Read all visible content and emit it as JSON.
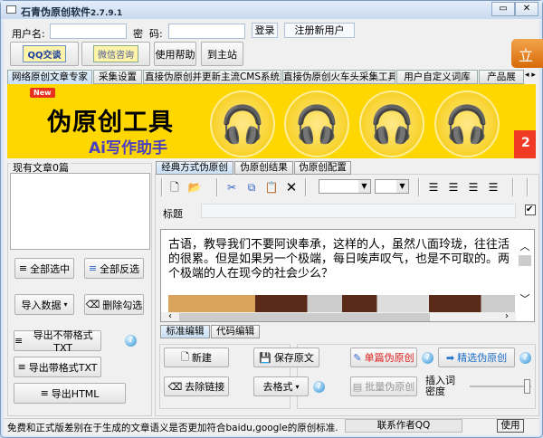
{
  "window": {
    "title": "石青伪原创软件",
    "version": "2.7.9.1",
    "min": "▭",
    "close": "✕"
  },
  "login": {
    "username_label": "用户名:",
    "username_value": "",
    "password_label": "密  码:",
    "password_value": "",
    "login_button": "登录",
    "register_button": "注册新用户"
  },
  "toolbar": {
    "qq": "QQ交谈",
    "wechat": "微信咨询",
    "help": "使用帮助",
    "home": "到主站",
    "orange": "立"
  },
  "tabs": [
    "网络原创文章专家",
    "采集设置",
    "直接伪原创并更新主流CMS系统",
    "直接伪原创火车头采集工具",
    "用户自定义词库",
    "产品展"
  ],
  "banner": {
    "badge": "New",
    "title": "伪原创工具",
    "subtitle": "Ai写作助手",
    "side": "2"
  },
  "left": {
    "group_title": "现有文章0篇",
    "select_all": "全部选中",
    "invert": "全部反选",
    "import": "导入数据",
    "delete_checked": "删除勾选",
    "export_plain": "导出不带格式TXT",
    "export_fmt": "导出带格式TXT",
    "export_html": "导出HTML"
  },
  "right": {
    "tabs": [
      "经典方式伪原创",
      "伪原创结果",
      "伪原创配置"
    ],
    "title_label": "标题",
    "title_value": "",
    "editor_text": "古语，教导我们不要阿谀奉承，这样的人，虽然八面玲珑，往往活的很累。但是如果另一个极端，每日唉声叹气，也是不可取的。两个极端的人在现今的社会少么？",
    "edit_tabs": [
      "标准编辑",
      "代码编辑"
    ],
    "new": "新建",
    "save": "保存原文",
    "remove_links": "去除链接",
    "remove_format": "去格式",
    "single": "单篇伪原创",
    "selected": "精选伪原创",
    "batch": "批量伪原创",
    "density_label": "插入词密度",
    "density_value": 1.0
  },
  "status": {
    "message": "免费和正式版差别在于生成的文章语义是否更加符合baidu,google的原创标准.",
    "contact": "联系作者QQ",
    "usage": "使用"
  },
  "colors": {
    "banner": "#FFD700",
    "single": "#e02020",
    "selected": "#1d6fc9"
  }
}
